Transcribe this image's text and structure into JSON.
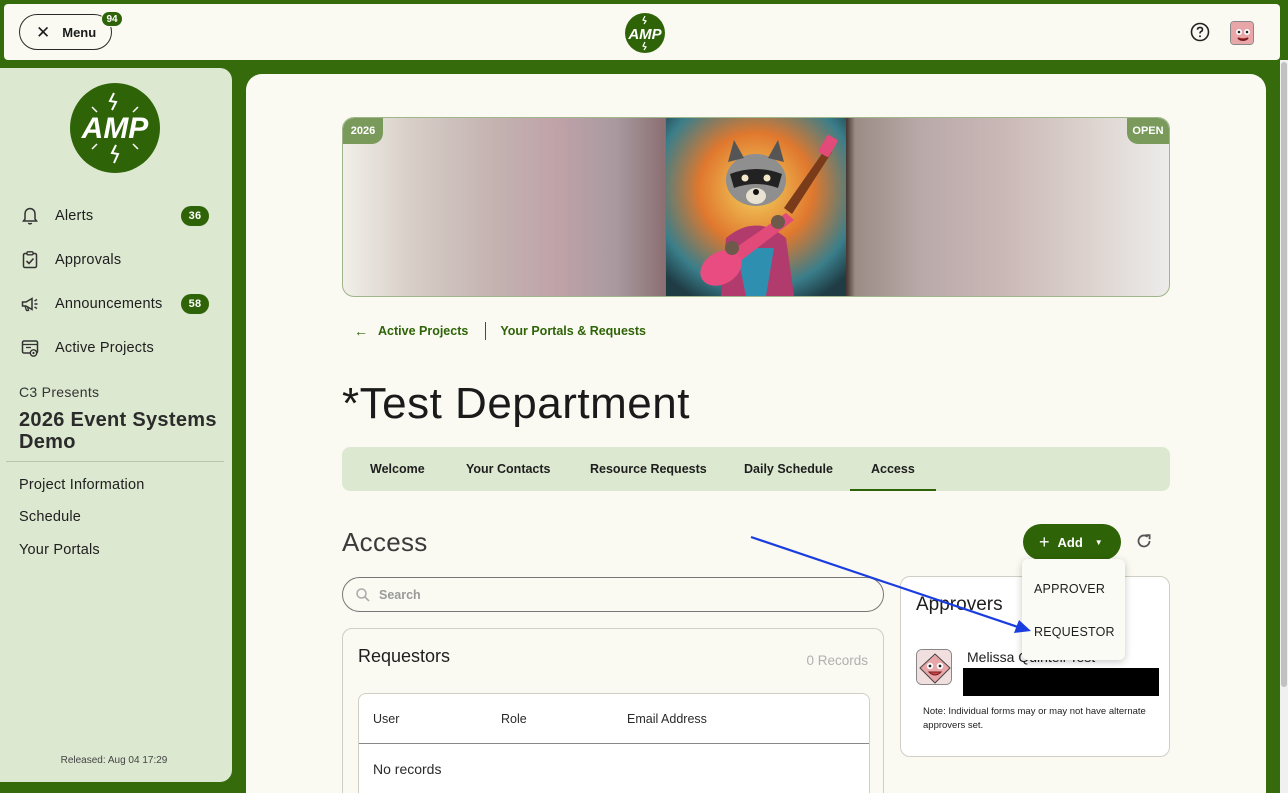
{
  "topbar": {
    "menu_label": "Menu",
    "menu_badge": "94",
    "logo_text": "AMP"
  },
  "sidebar": {
    "logo_text": "AMP",
    "items": [
      {
        "label": "Alerts",
        "icon": "bell-icon",
        "badge": "36"
      },
      {
        "label": "Approvals",
        "icon": "clipboard-check-icon"
      },
      {
        "label": "Announcements",
        "icon": "megaphone-icon",
        "badge": "58"
      },
      {
        "label": "Active Projects",
        "icon": "projects-icon"
      }
    ],
    "presenter": "C3 Presents",
    "project_title": "2026 Event Systems Demo",
    "links": [
      "Project Information",
      "Schedule",
      "Your Portals"
    ],
    "released": "Released: Aug 04 17:29"
  },
  "banner": {
    "year_tag": "2026",
    "status_tag": "OPEN"
  },
  "breadcrumbs": {
    "back": "Active Projects",
    "current": "Your Portals & Requests"
  },
  "page": {
    "title": "*Test Department"
  },
  "tabs": [
    {
      "label": "Welcome"
    },
    {
      "label": "Your Contacts"
    },
    {
      "label": "Resource Requests"
    },
    {
      "label": "Daily Schedule"
    },
    {
      "label": "Access",
      "active": true
    }
  ],
  "access": {
    "title": "Access",
    "add_label": "Add",
    "search_placeholder": "Search",
    "dropdown": [
      "APPROVER",
      "REQUESTOR"
    ]
  },
  "requestors": {
    "title": "Requestors",
    "count": "0 Records",
    "columns": [
      "User",
      "Role",
      "Email Address"
    ],
    "empty": "No records"
  },
  "approvers": {
    "title": "Approvers",
    "name": "Melissa Quintell Test",
    "note": "Note: Individual forms may or may not have alternate approvers set."
  },
  "colors": {
    "brand_green": "#2e6407",
    "sidebar_bg": "#dce8d0",
    "page_bg": "#fafaf3",
    "annotation_arrow": "#1a3de0"
  }
}
